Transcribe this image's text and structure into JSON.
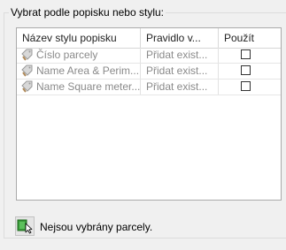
{
  "group": {
    "title": "Vybrat podle popisku nebo stylu:"
  },
  "grid": {
    "columns": [
      "Název stylu popisku",
      "Pravidlo v...",
      "Použít"
    ],
    "rows": [
      {
        "name": "Číslo parcely",
        "rule": "Přidat exist...",
        "use": false
      },
      {
        "name": "Name Area & Perim...",
        "rule": "Přidat exist...",
        "use": false
      },
      {
        "name": "Name Square meter...",
        "rule": "Přidat exist...",
        "use": false
      }
    ]
  },
  "status": {
    "icon": "select-parcels-icon",
    "text": "Nejsou vybrány parcely."
  }
}
